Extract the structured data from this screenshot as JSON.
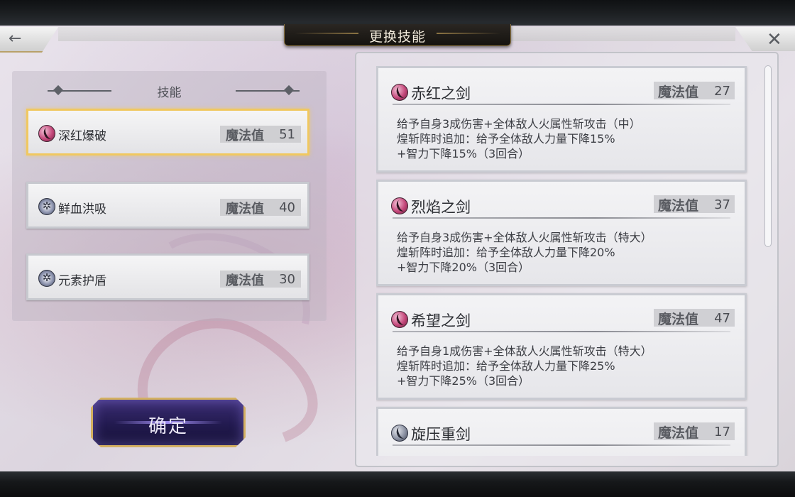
{
  "header": {
    "title": "更换技能",
    "back_icon": "←",
    "close_icon": "✕"
  },
  "left_panel": {
    "heading": "技能",
    "slots": [
      {
        "name": "深红爆破",
        "mp_label": "魔法值",
        "mp": "51",
        "icon": "fire-sword-icon",
        "selected": true
      },
      {
        "name": "鲜血洪吸",
        "mp_label": "魔法值",
        "mp": "40",
        "icon": "star-icon",
        "selected": false
      },
      {
        "name": "元素护盾",
        "mp_label": "魔法值",
        "mp": "30",
        "icon": "star-icon",
        "selected": false
      }
    ]
  },
  "confirm": {
    "label": "确定"
  },
  "skills": [
    {
      "name": "赤红之剑",
      "mp_label": "魔法值",
      "mp": "27",
      "icon": "fire-sword-icon",
      "desc": [
        "给予自身3成伤害+全体敌人火属性斩攻击（中）",
        "煌斩阵时追加：给予全体敌人力量下降15%",
        "+智力下降15%（3回合）"
      ]
    },
    {
      "name": "烈焰之剑",
      "mp_label": "魔法值",
      "mp": "37",
      "icon": "fire-sword-icon",
      "desc": [
        "给予自身3成伤害+全体敌人火属性斩攻击（特大）",
        "煌斩阵时追加：给予全体敌人力量下降20%",
        "+智力下降20%（3回合）"
      ]
    },
    {
      "name": "希望之剑",
      "mp_label": "魔法值",
      "mp": "47",
      "icon": "fire-sword-icon",
      "desc": [
        "给予自身1成伤害+全体敌人火属性斩攻击（特大）",
        "煌斩阵时追加：给予全体敌人力量下降25%",
        "+智力下降25%（3回合）"
      ]
    },
    {
      "name": "旋压重剑",
      "mp_label": "魔法值",
      "mp": "17",
      "icon": "sword-icon",
      "desc": []
    }
  ]
}
